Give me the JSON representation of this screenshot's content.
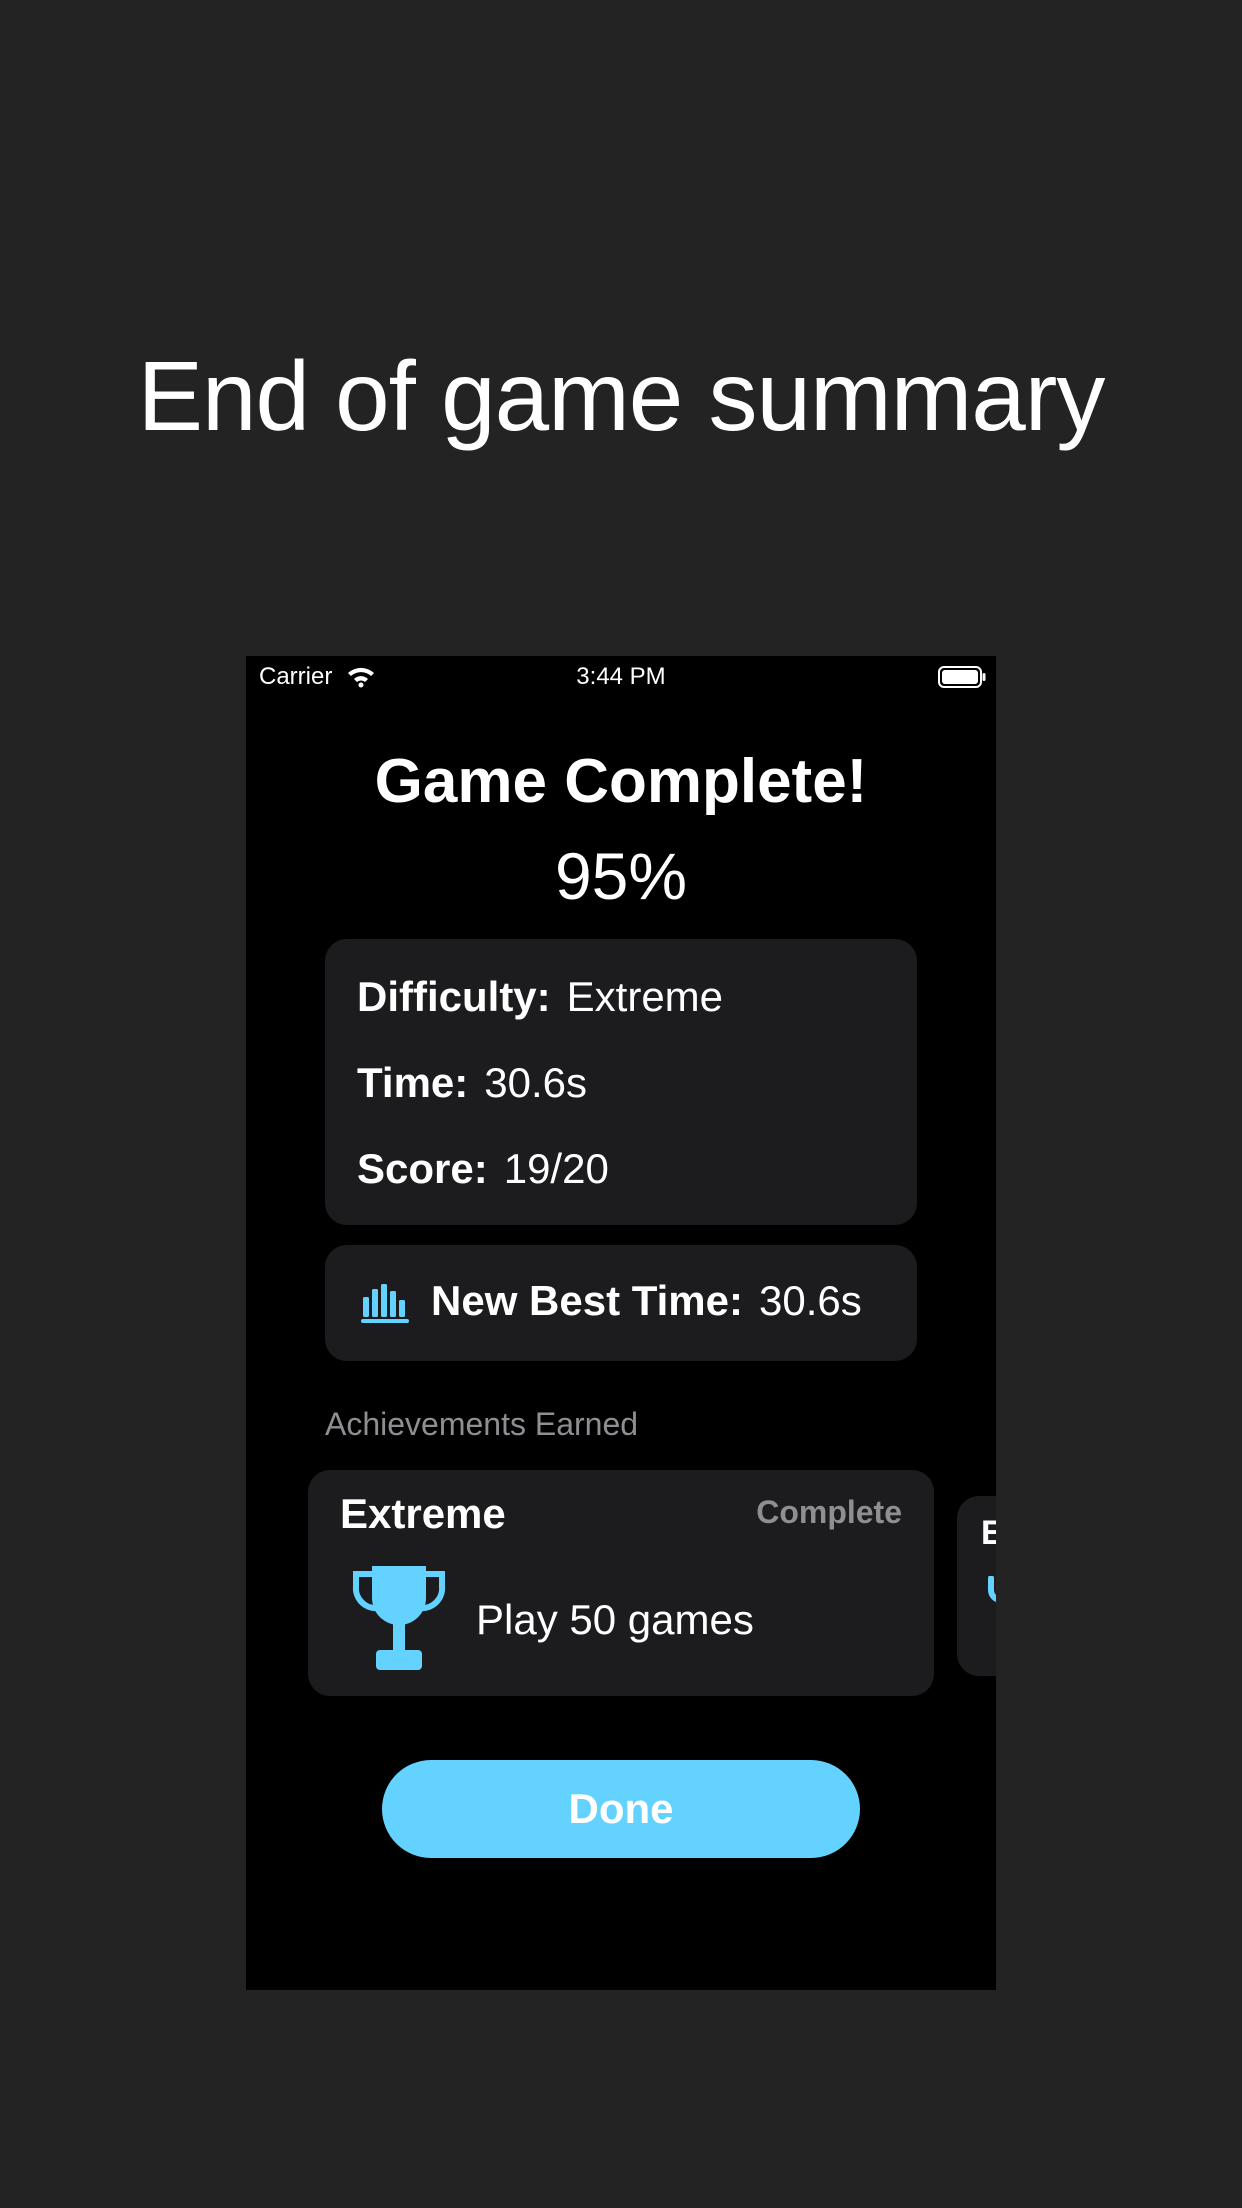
{
  "headline": "End of game summary",
  "status_bar": {
    "carrier": "Carrier",
    "time": "3:44 PM"
  },
  "summary": {
    "title": "Game Complete!",
    "percent": "95%",
    "stats": [
      {
        "label": "Difficulty:",
        "value": "Extreme"
      },
      {
        "label": "Time:",
        "value": "30.6s"
      },
      {
        "label": "Score:",
        "value": "19/20"
      }
    ],
    "best": {
      "icon": "chart-bar-icon",
      "label": "New Best Time:",
      "value": "30.6s"
    }
  },
  "achievements": {
    "section_label": "Achievements Earned",
    "items": [
      {
        "title": "Extreme",
        "status": "Complete",
        "icon": "trophy-icon",
        "description": "Play 50 games"
      },
      {
        "title": "E",
        "icon": "trophy-icon"
      }
    ]
  },
  "done_button": "Done",
  "colors": {
    "page_background": "#232323",
    "screen_background": "#000000",
    "card_background": "#1c1c1e",
    "accent": "#64d2ff",
    "secondary_text": "#8e8e93"
  }
}
